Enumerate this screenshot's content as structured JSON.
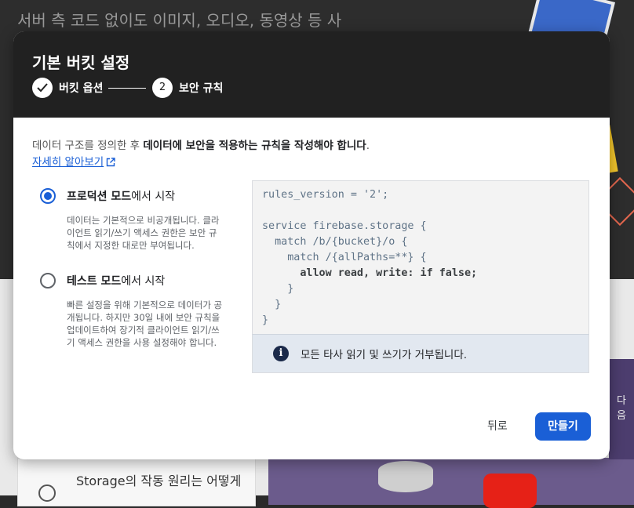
{
  "background": {
    "hero_text": "서버 측 코드 없이도 이미지, 오디오, 동영상 등 사",
    "help_card_text": "Storage의 작동 원리는 어떻게",
    "side_text": "다음"
  },
  "dialog": {
    "title": "기본 버킷 설정",
    "steps": [
      {
        "label": "버킷 옵션",
        "state": "done"
      },
      {
        "number": "2",
        "label": "보안 규칙",
        "state": "current"
      }
    ],
    "intro_plain": "데이터 구조를 정의한 후 ",
    "intro_bold": "데이터에 보안을 적용하는 규칙을 작성해야 합니다",
    "intro_end": ".",
    "learn_more": "자세히 알아보기",
    "options": [
      {
        "title_bold": "프로덕션 모드",
        "title_rest": "에서 시작",
        "selected": true,
        "desc": "데이터는 기본적으로 비공개됩니다. 클라이언트 읽기/쓰기 액세스 권한은 보안 규칙에서 지정한 대로만 부여됩니다."
      },
      {
        "title_bold": "테스트 모드",
        "title_rest": "에서 시작",
        "selected": false,
        "desc": "빠른 설정을 위해 기본적으로 데이터가 공개됩니다. 하지만 30일 내에 보안 규칙을 업데이트하여 장기적 클라이언트 읽기/쓰기 액세스 권한을 사용 설정해야 합니다."
      }
    ],
    "code": {
      "line1": "rules_version = '2';",
      "line2": "",
      "line3": "service firebase.storage {",
      "line4": "  match /b/{bucket}/o {",
      "line5": "    match /{allPaths=**} {",
      "line6": "      allow read, write: if false;",
      "line7": "    }",
      "line8": "  }",
      "line9": "}"
    },
    "info_message": "모든 타사 읽기 및 쓰기가 거부됩니다.",
    "back_label": "뒤로",
    "create_label": "만들기",
    "accent_color": "#1a5fd6"
  }
}
